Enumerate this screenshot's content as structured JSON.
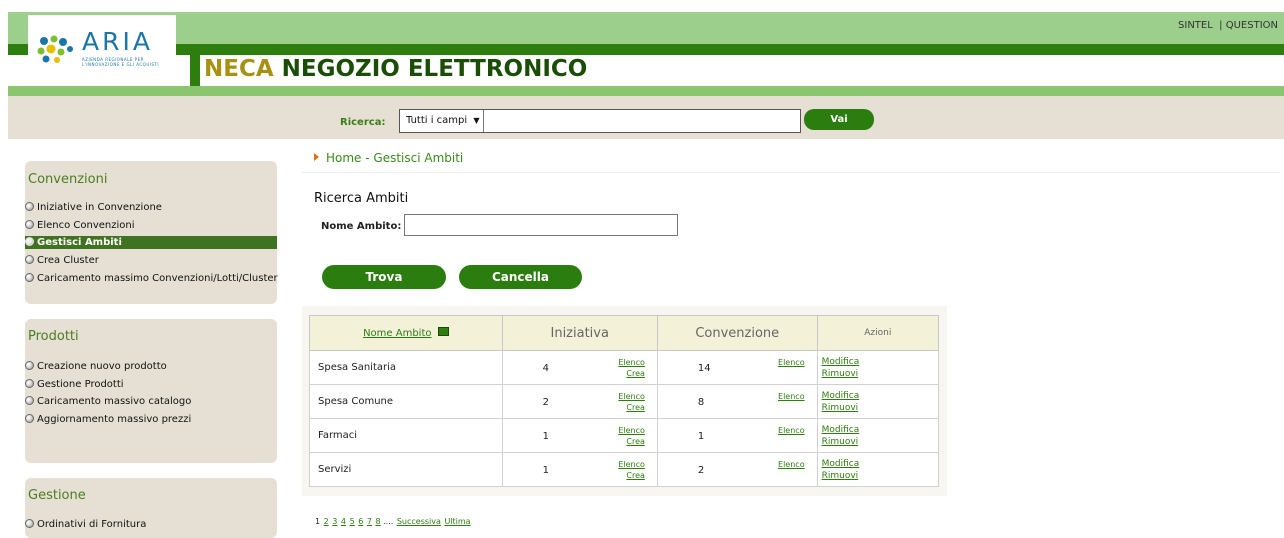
{
  "header": {
    "logo_text": "ARIA",
    "logo_subtitle": "AZIENDA REGIONALE PER L'INNOVAZIONE E GLI ACQUISTI",
    "title_highlight": "NECA",
    "title_rest": "NEGOZIO ELETTRONICO",
    "top_links": [
      "SINTEL",
      "QUESTION"
    ]
  },
  "search": {
    "label": "Ricerca:",
    "select_value": "Tutti i campi",
    "query": "",
    "button_label": "Vai"
  },
  "sidebar": {
    "sections": [
      {
        "title": "Convenzioni",
        "items": [
          "Iniziative in Convenzione",
          "Elenco Convenzioni",
          "Gestisci Ambiti",
          "Crea Cluster",
          "Caricamento massimo Convenzioni/Lotti/Cluster"
        ],
        "active_item": "Gestisci Ambiti"
      },
      {
        "title": "Prodotti",
        "items": [
          "Creazione nuovo prodotto",
          "Gestione Prodotti",
          "Caricamento massivo catalogo",
          "Aggiornamento massivo prezzi"
        ]
      },
      {
        "title": "Gestione",
        "items": [
          "Ordinativi di Fornitura"
        ]
      }
    ]
  },
  "breadcrumb": "Home - Gestisci Ambiti",
  "form": {
    "title": "Ricerca Ambiti",
    "field_label": "Nome Ambito:",
    "field_value": "",
    "trova_label": "Trova",
    "cancella_label": "Cancella"
  },
  "table": {
    "headers": [
      "Nome Ambito",
      "Iniziativa",
      "Convenzione",
      "Azioni"
    ],
    "rows": [
      {
        "name": "Spesa Sanitaria",
        "iniziativa": "4",
        "convenzione": "14"
      },
      {
        "name": "Spesa Comune",
        "iniziativa": "2",
        "convenzione": "8"
      },
      {
        "name": "Farmaci",
        "iniziativa": "1",
        "convenzione": "1"
      },
      {
        "name": "Servizi",
        "iniziativa": "1",
        "convenzione": "2"
      }
    ],
    "link_elenco": "Elenco",
    "link_crea": "Crea",
    "link_modifica": "Modifica",
    "link_rimuovi": "Rimuovi"
  },
  "pagination": {
    "current": "1",
    "pages": [
      "2",
      "3",
      "4",
      "5",
      "6",
      "7",
      "8"
    ],
    "ellipsis": "....",
    "next": "Successiva",
    "last": "Ultima"
  },
  "colors": {
    "brand_green": "#2e7d0f",
    "header_light_green": "#9ccf8c",
    "neca_gold": "#a79113",
    "panel_beige": "#e5e0d3"
  }
}
